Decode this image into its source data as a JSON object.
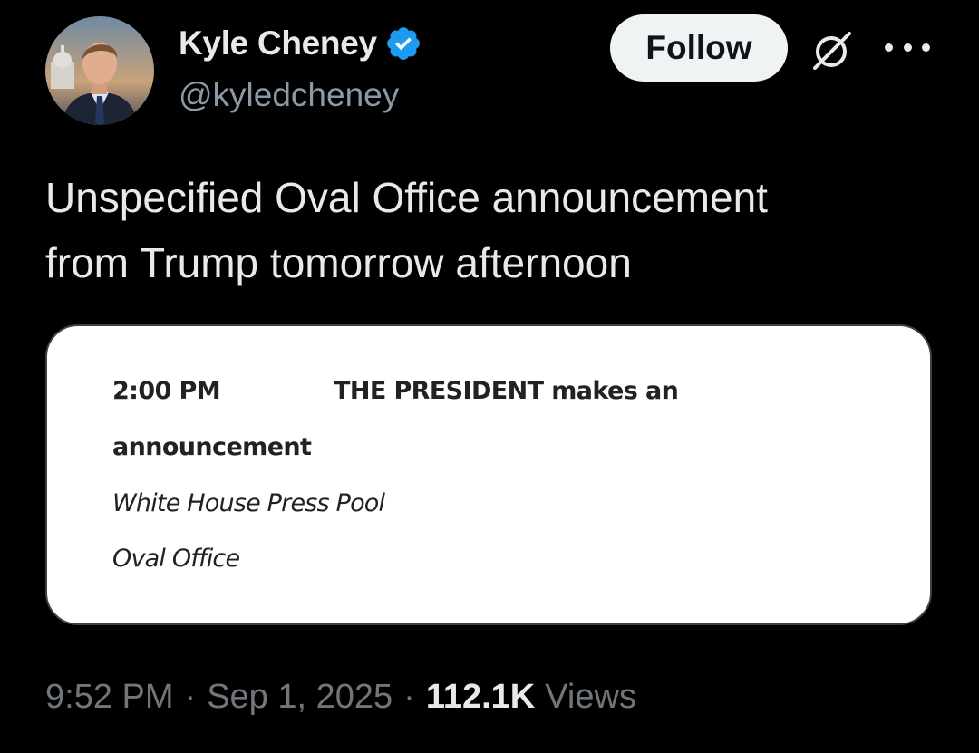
{
  "author": {
    "display_name": "Kyle Cheney",
    "handle": "@kyledcheney",
    "verified": true,
    "verified_color": "#1d9bf0"
  },
  "actions": {
    "follow_label": "Follow",
    "grok_icon": "grok-icon",
    "more_icon": "more-options-icon"
  },
  "tweet": {
    "text_lines": [
      "Unspecified Oval Office announcement",
      "from Trump tomorrow afternoon"
    ]
  },
  "media": {
    "schedule": {
      "time": "2:00 PM",
      "title_line_1": "THE PRESIDENT makes an",
      "title_line_2": "announcement",
      "coverage": "White House Press Pool",
      "location": "Oval Office"
    }
  },
  "meta": {
    "time": "9:52 PM",
    "separator": "·",
    "date": "Sep 1, 2025",
    "views_count": "112.1K",
    "views_label": "Views"
  }
}
